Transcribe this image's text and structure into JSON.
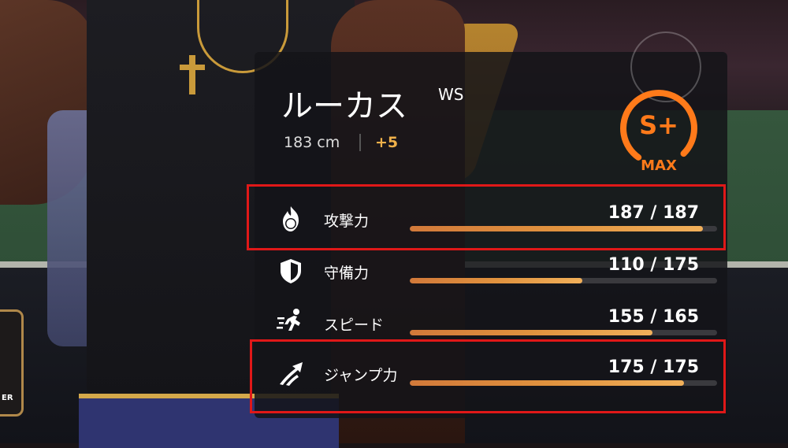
{
  "player": {
    "name": "ルーカス",
    "position": "WS",
    "height": "183 cm",
    "bonus": "+5"
  },
  "rank": {
    "grade": "S+",
    "status": "MAX",
    "color": "#ff7a1a"
  },
  "left_badge_text": "ER",
  "stats": [
    {
      "label": "攻撃力",
      "value": "187 / 187",
      "current": 187,
      "max": 187,
      "icon": "fire-volleyball-icon",
      "highlighted": true
    },
    {
      "label": "守備力",
      "value": "110 / 175",
      "current": 110,
      "max": 175,
      "icon": "shield-icon",
      "highlighted": false
    },
    {
      "label": "スピード",
      "value": "155 / 165",
      "current": 155,
      "max": 165,
      "icon": "running-figure-icon",
      "highlighted": false
    },
    {
      "label": "ジャンプ力",
      "value": "175 / 175",
      "current": 175,
      "max": 175,
      "icon": "jump-arrow-icon",
      "highlighted": true
    }
  ],
  "colors": {
    "highlight": "#e01818",
    "bonus": "#f0b14a",
    "bar": "#e0923e"
  }
}
